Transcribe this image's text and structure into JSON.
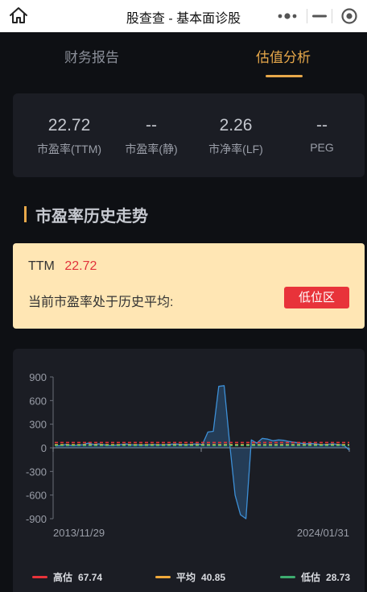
{
  "nav": {
    "title": "股查查 - 基本面诊股",
    "home_icon": "home-icon",
    "more_icon": "more-dots-icon",
    "minimize_icon": "minimize-icon",
    "close_icon": "close-target-icon"
  },
  "tabs": [
    {
      "label": "财务报告",
      "active": false
    },
    {
      "label": "估值分析",
      "active": true
    }
  ],
  "metrics": [
    {
      "value": "22.72",
      "label": "市盈率(TTM)"
    },
    {
      "value": "--",
      "label": "市盈率(静)"
    },
    {
      "value": "2.26",
      "label": "市净率(LF)"
    },
    {
      "value": "--",
      "label": "PEG"
    }
  ],
  "section": {
    "title": "市盈率历史走势"
  },
  "status": {
    "ttm_label": "TTM",
    "ttm_value": "22.72",
    "text": "当前市盈率处于历史平均:",
    "badge": "低位区"
  },
  "colors": {
    "accent": "#e7a84a",
    "high": "#e8333a",
    "avg": "#f0a93b",
    "low": "#3dac6f",
    "line": "#3d8fd6"
  },
  "chart_data": {
    "type": "line",
    "title": "",
    "xlabel": "",
    "ylabel": "",
    "x_tick_labels": [
      "2013/11/29",
      "2024/01/31"
    ],
    "y_ticks": [
      900,
      600,
      300,
      0,
      -300,
      -600,
      -900
    ],
    "ylim": [
      -900,
      900
    ],
    "grid": false,
    "series": [
      {
        "values": [
          25,
          30,
          45,
          28,
          35,
          40,
          60,
          42,
          50,
          38,
          30,
          35,
          42,
          48,
          40,
          38,
          36,
          40,
          42,
          38,
          40,
          45,
          48,
          44,
          40,
          45,
          50,
          42,
          200,
          210,
          780,
          790,
          60,
          -600,
          -850,
          -900,
          100,
          60,
          120,
          110,
          90,
          100,
          95,
          80,
          70,
          60,
          50,
          55,
          48,
          40,
          45,
          50,
          42,
          35,
          -30
        ]
      }
    ],
    "reference_lines": [
      {
        "name": "高估",
        "value": 67.74
      },
      {
        "name": "平均",
        "value": 40.85
      },
      {
        "name": "低估",
        "value": 28.73
      }
    ]
  },
  "legend": [
    {
      "name": "高估",
      "value": "67.74"
    },
    {
      "name": "平均",
      "value": "40.85"
    },
    {
      "name": "低估",
      "value": "28.73"
    }
  ]
}
